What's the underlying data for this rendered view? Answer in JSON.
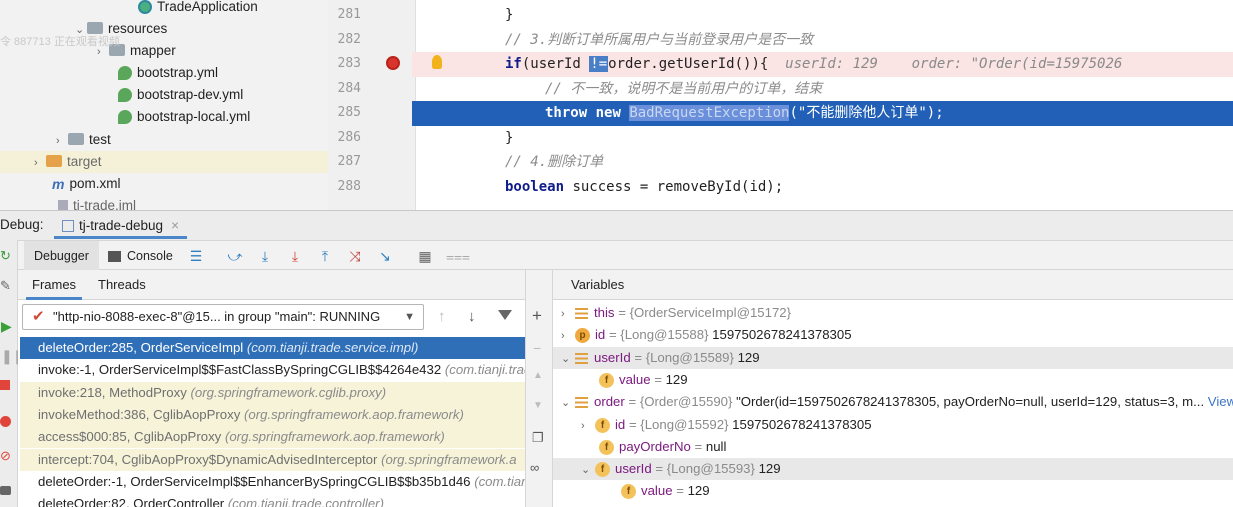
{
  "project_tree": {
    "items": [
      {
        "label": "TradeApplication",
        "icon": "spring-boot-app-icon"
      },
      {
        "label": "resources",
        "icon": "resources-folder-icon"
      },
      {
        "label": "mapper",
        "icon": "folder-icon"
      },
      {
        "label": "bootstrap.yml",
        "icon": "yaml-icon"
      },
      {
        "label": "bootstrap-dev.yml",
        "icon": "yaml-icon"
      },
      {
        "label": "bootstrap-local.yml",
        "icon": "yaml-icon"
      },
      {
        "label": "test",
        "icon": "folder-icon"
      },
      {
        "label": "target",
        "icon": "excluded-folder-icon"
      },
      {
        "label": "pom.xml",
        "icon": "maven-icon"
      },
      {
        "label": "tj-trade.iml",
        "icon": "iml-file-icon"
      }
    ],
    "watermark": "令 887713 正在观看视频"
  },
  "editor": {
    "line_numbers": [
      "281",
      "282",
      "283",
      "284",
      "285",
      "286",
      "287",
      "288"
    ],
    "lines": {
      "l281": "}",
      "l282": "// 3.判断订单所属用户与当前登录用户是否一致",
      "l283_if": "if",
      "l283_a": "(userId ",
      "l283_op": "!=",
      "l283_b": "order.getUserId()){",
      "l283_inline_userid": "userId: 129",
      "l283_inline_order": "order: \"Order(id=15975026",
      "l284": "// 不一致，说明不是当前用户的订单，结束",
      "l285_throw": "throw",
      "l285_new": "new",
      "l285_class": "BadRequestException",
      "l285_rest": "(\"不能删除他人订单\");",
      "l286": "}",
      "l287": "// 4.删除订单",
      "l288_kw": "boolean",
      "l288_rest": " success = removeById(id);"
    }
  },
  "debug": {
    "title_label": "Debug:",
    "session_tab": "tj-trade-debug",
    "tabs": {
      "debugger": "Debugger",
      "console": "Console"
    },
    "frames_tabs": {
      "frames": "Frames",
      "threads": "Threads"
    },
    "thread_selector": "\"http-nio-8088-exec-8\"@15... in group \"main\": RUNNING",
    "frames": [
      {
        "method": "deleteOrder:285, OrderServiceImpl",
        "pkg": "(com.tianji.trade.service.impl)"
      },
      {
        "method": "invoke:-1, OrderServiceImpl$$FastClassBySpringCGLIB$$4264e432",
        "pkg": "(com.tianji.trad"
      },
      {
        "method": "invoke:218, MethodProxy",
        "pkg": "(org.springframework.cglib.proxy)"
      },
      {
        "method": "invokeMethod:386, CglibAopProxy",
        "pkg": "(org.springframework.aop.framework)"
      },
      {
        "method": "access$000:85, CglibAopProxy",
        "pkg": "(org.springframework.aop.framework)"
      },
      {
        "method": "intercept:704, CglibAopProxy$DynamicAdvisedInterceptor",
        "pkg": "(org.springframework.a"
      },
      {
        "method": "deleteOrder:-1, OrderServiceImpl$$EnhancerBySpringCGLIB$$b35b1d46",
        "pkg": "(com.tian"
      },
      {
        "method": "deleteOrder:82, OrderController",
        "pkg": "(com.tianji.trade.controller)"
      }
    ],
    "variables_title": "Variables",
    "variables": [
      {
        "name": "this",
        "type": "= {OrderServiceImpl@15172}",
        "value": ""
      },
      {
        "name": "id",
        "type": "= {Long@15588}",
        "value": " 1597502678241378305"
      },
      {
        "name": "userId",
        "type": "= {Long@15589}",
        "value": " 129"
      },
      {
        "name": "value",
        "type": "= ",
        "value": "129"
      },
      {
        "name": "order",
        "type": "= {Order@15590}",
        "value": " \"Order(id=1597502678241378305, payOrderNo=null, userId=129, status=3, m...",
        "link": "View"
      },
      {
        "name": "id",
        "type": "= {Long@15592}",
        "value": " 1597502678241378305"
      },
      {
        "name": "payOrderNo",
        "type": "= ",
        "value": "null"
      },
      {
        "name": "userId",
        "type": "= {Long@15593}",
        "value": " 129"
      },
      {
        "name": "value",
        "type": "= ",
        "value": "129"
      }
    ]
  }
}
